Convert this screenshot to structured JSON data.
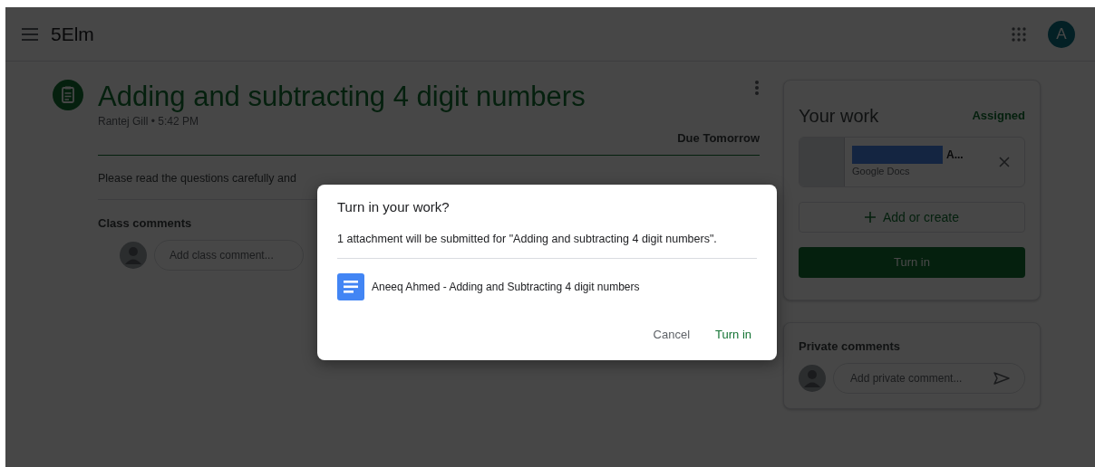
{
  "header": {
    "title": "5Elm",
    "avatar_letter": "A"
  },
  "assignment": {
    "title": "Adding and subtracting 4 digit numbers",
    "byline": "Rantej Gill • 5:42 PM",
    "due": "Due Tomorrow",
    "description": "Please read the questions carefully and",
    "comments_heading": "Class comments",
    "comment_placeholder": "Add class comment..."
  },
  "your_work": {
    "title": "Your work",
    "status": "Assigned",
    "attachment": {
      "name": "A...",
      "type": "Google Docs"
    },
    "add_button": "Add or create",
    "turn_in_button": "Turn in"
  },
  "private_comments": {
    "heading": "Private comments",
    "placeholder": "Add private comment..."
  },
  "dialog": {
    "title": "Turn in your work?",
    "message": "1 attachment will be submitted for \"Adding and subtracting 4 digit numbers\".",
    "attachment": "Aneeq Ahmed - Adding and Subtracting 4 digit numbers",
    "buttons": [
      {
        "label": "Cancel",
        "kind": "secondary"
      },
      {
        "label": "Turn in",
        "kind": "primary"
      }
    ]
  }
}
